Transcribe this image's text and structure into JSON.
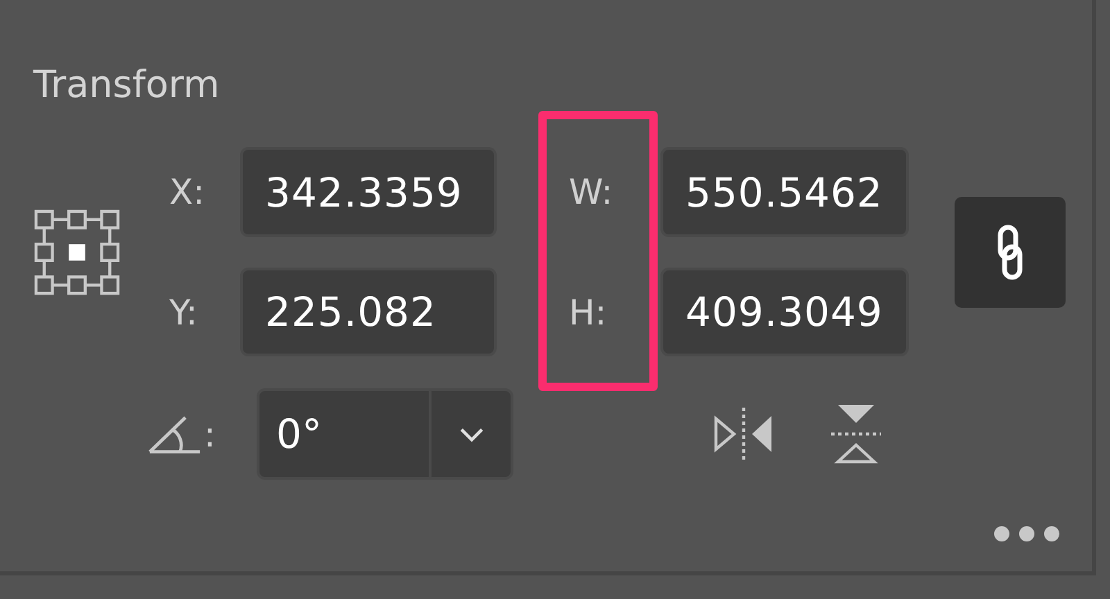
{
  "panel": {
    "title": "Transform"
  },
  "position_fields": [
    {
      "label": "X:",
      "value": "342.3359"
    },
    {
      "label": "Y:",
      "value": "225.082"
    }
  ],
  "size_fields": [
    {
      "label": "W:",
      "value": "550.5462"
    },
    {
      "label": "H:",
      "value": "409.3049"
    }
  ],
  "size_labels_highlighted": true,
  "constrain_proportions": {
    "on": true
  },
  "rotation": {
    "label": ":",
    "value": "0°"
  }
}
